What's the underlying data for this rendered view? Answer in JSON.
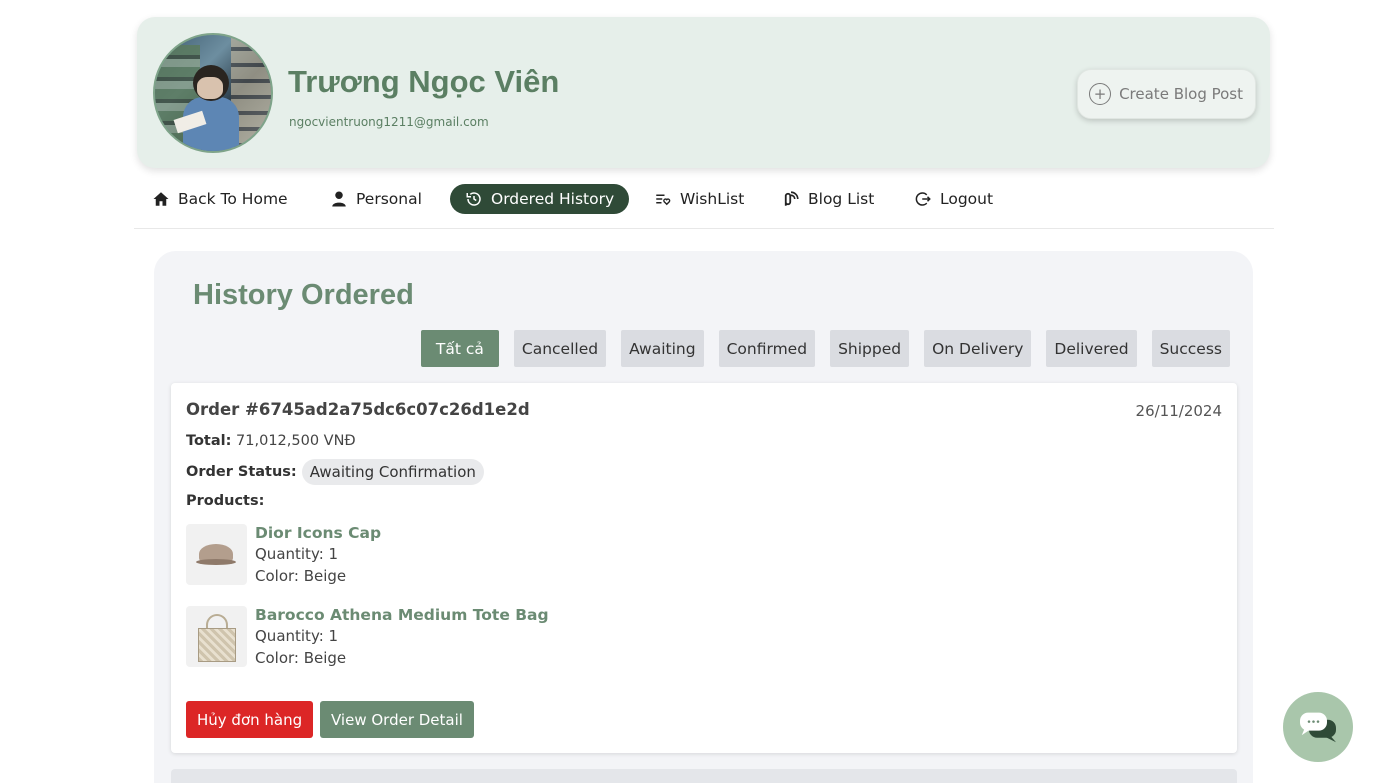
{
  "profile": {
    "name": "Trương Ngọc Viên",
    "email": "ngocvientruong1211@gmail.com",
    "create_post_label": "Create Blog Post"
  },
  "nav": {
    "items": [
      {
        "label": "Back To Home",
        "icon": "home-icon"
      },
      {
        "label": "Personal",
        "icon": "user-icon"
      },
      {
        "label": "Ordered History",
        "icon": "history-icon",
        "active": true
      },
      {
        "label": "WishList",
        "icon": "wishlist-icon"
      },
      {
        "label": "Blog List",
        "icon": "blog-icon"
      },
      {
        "label": "Logout",
        "icon": "logout-icon"
      }
    ]
  },
  "history": {
    "title": "History Ordered",
    "filters": [
      "Tất cả",
      "Cancelled",
      "Awaiting",
      "Confirmed",
      "Shipped",
      "On Delivery",
      "Delivered",
      "Success"
    ],
    "active_filter": "Tất cả"
  },
  "order": {
    "id": "Order #6745ad2a75dc6c07c26d1e2d",
    "date": "26/11/2024",
    "total_label": "Total:",
    "total_value": "71,012,500 VNĐ",
    "status_label": "Order Status:",
    "status_value": "Awaiting Confirmation",
    "products_label": "Products:",
    "products": [
      {
        "name": "Dior Icons Cap",
        "quantity": "Quantity: 1",
        "color": "Color: Beige"
      },
      {
        "name": "Barocco Athena Medium Tote Bag",
        "quantity": "Quantity: 1",
        "color": "Color: Beige"
      }
    ],
    "cancel_label": "Hủy đơn hàng",
    "detail_label": "View Order Detail"
  },
  "colors": {
    "accent": "#6b8b73",
    "nav_active": "#2f4a37",
    "danger": "#dc2626",
    "header_bg": "#e6efea"
  }
}
